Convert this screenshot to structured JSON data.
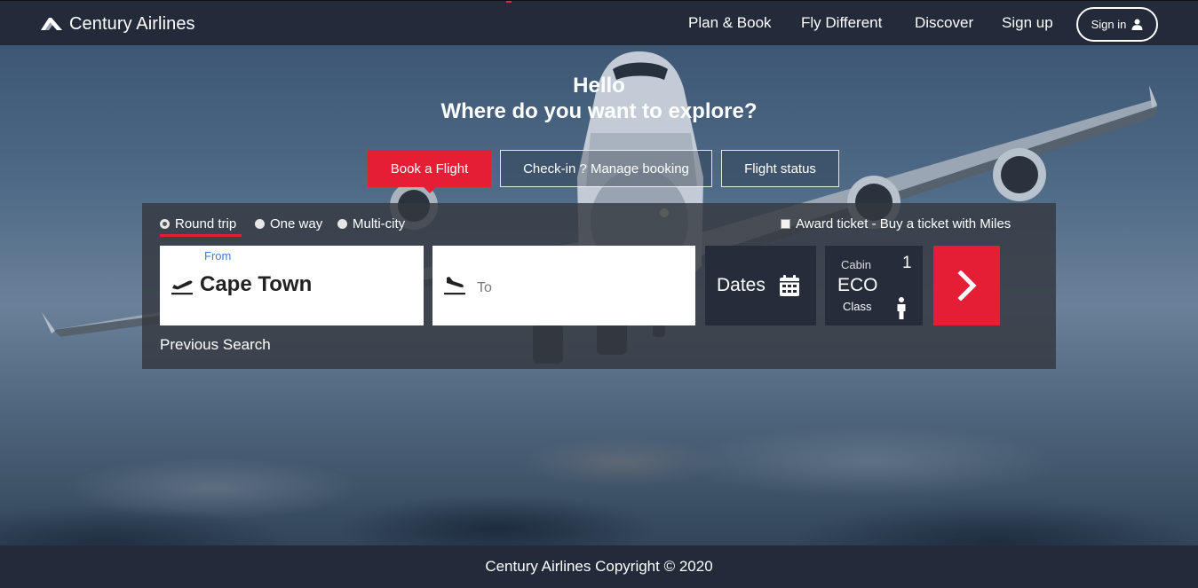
{
  "brand": {
    "name": "Century Airlines"
  },
  "nav": {
    "items": [
      "Plan & Book",
      "Fly Different",
      "Discover",
      "Sign up"
    ],
    "signin_label": "Sign in"
  },
  "hero": {
    "greeting": "Hello",
    "headline": "Where do you want to explore?"
  },
  "tabs": [
    "Book a Flight",
    "Check-in ? Manage booking",
    "Flight status"
  ],
  "trip_types": {
    "selected": "Round trip",
    "options": [
      "Round trip",
      "One way",
      "Multi-city"
    ]
  },
  "award_ticket": {
    "label": "Award ticket - Buy a ticket with Miles",
    "checked": false
  },
  "search": {
    "from_label": "From",
    "from_value": "Cape Town",
    "to_placeholder": "To",
    "dates_label": "Dates",
    "cabin_label": "Cabin",
    "passengers": "1",
    "cabin_value": "ECO",
    "class_label": "Class"
  },
  "previous_search": "Previous Search",
  "footer": {
    "copyright": "Century Airlines Copyright © 2020"
  },
  "colors": {
    "accent": "#e61e35",
    "bar": "#232a3a",
    "panel": "#262c3a",
    "link": "#3b7dd8"
  },
  "icons": [
    "airline-logo-icon",
    "user-icon",
    "takeoff-icon",
    "landing-icon",
    "calendar-icon",
    "person-icon",
    "chevron-right-icon"
  ]
}
